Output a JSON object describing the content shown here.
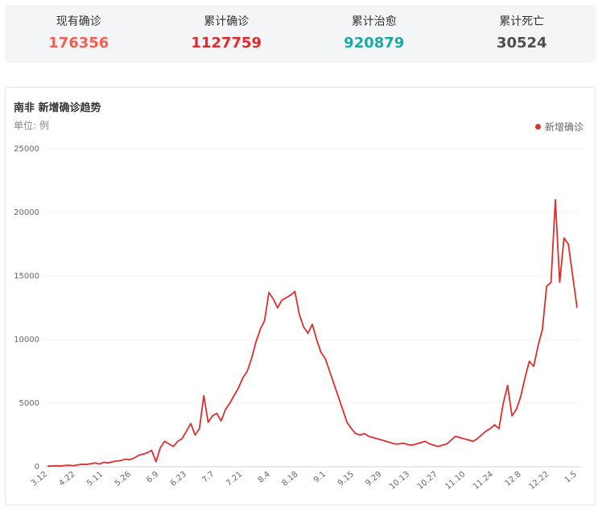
{
  "summary": {
    "items": [
      {
        "label": "现有确诊",
        "value": "176356",
        "color": "#f4604f"
      },
      {
        "label": "累计确诊",
        "value": "1127759",
        "color": "#e02b2b"
      },
      {
        "label": "累计治愈",
        "value": "920879",
        "color": "#1aa9a4"
      },
      {
        "label": "累计死亡",
        "value": "30524",
        "color": "#4e4e4e"
      }
    ]
  },
  "chart": {
    "title": "南非 新增确诊趋势",
    "unit": "单位: 例",
    "legend_label": "新增确诊",
    "line_color": "#de2e2e"
  },
  "chart_data": {
    "type": "line",
    "ylim": [
      0,
      25000
    ],
    "yticks": [
      0,
      5000,
      10000,
      15000,
      20000,
      25000
    ],
    "xticks": [
      "3.12",
      "4.22",
      "5.11",
      "5.26",
      "6.9",
      "6.23",
      "7.7",
      "7.21",
      "8.4",
      "8.18",
      "9.1",
      "9.15",
      "9.29",
      "10.13",
      "10.27",
      "11.10",
      "11.24",
      "12.8",
      "12.22",
      "1.5"
    ],
    "series": [
      {
        "name": "新增确诊",
        "values": [
          50,
          60,
          80,
          50,
          100,
          120,
          90,
          150,
          200,
          180,
          250,
          300,
          220,
          350,
          300,
          400,
          450,
          500,
          600,
          550,
          700,
          900,
          1000,
          1100,
          1300,
          400,
          1500,
          2000,
          1800,
          1600,
          2000,
          2200,
          2800,
          3400,
          2500,
          3000,
          5600,
          3500,
          4000,
          4200,
          3600,
          4500,
          5000,
          5600,
          6200,
          7000,
          7500,
          8500,
          9800,
          10800,
          11500,
          13700,
          13200,
          12500,
          13100,
          13300,
          13500,
          13800,
          12000,
          11000,
          10500,
          11200,
          10000,
          9000,
          8500,
          7500,
          6500,
          5500,
          4500,
          3500,
          3000,
          2600,
          2500,
          2600,
          2400,
          2300,
          2200,
          2100,
          2000,
          1900,
          1800,
          1800,
          1850,
          1750,
          1700,
          1800,
          1900,
          2000,
          1800,
          1700,
          1600,
          1700,
          1800,
          2100,
          2400,
          2300,
          2200,
          2100,
          2000,
          2200,
          2500,
          2800,
          3000,
          3300,
          3000,
          5000,
          6400,
          4000,
          4500,
          5500,
          7000,
          8300,
          7900,
          9500,
          10800,
          14200,
          14500,
          21000,
          14500,
          18000,
          17500,
          15000,
          12500
        ]
      }
    ]
  }
}
